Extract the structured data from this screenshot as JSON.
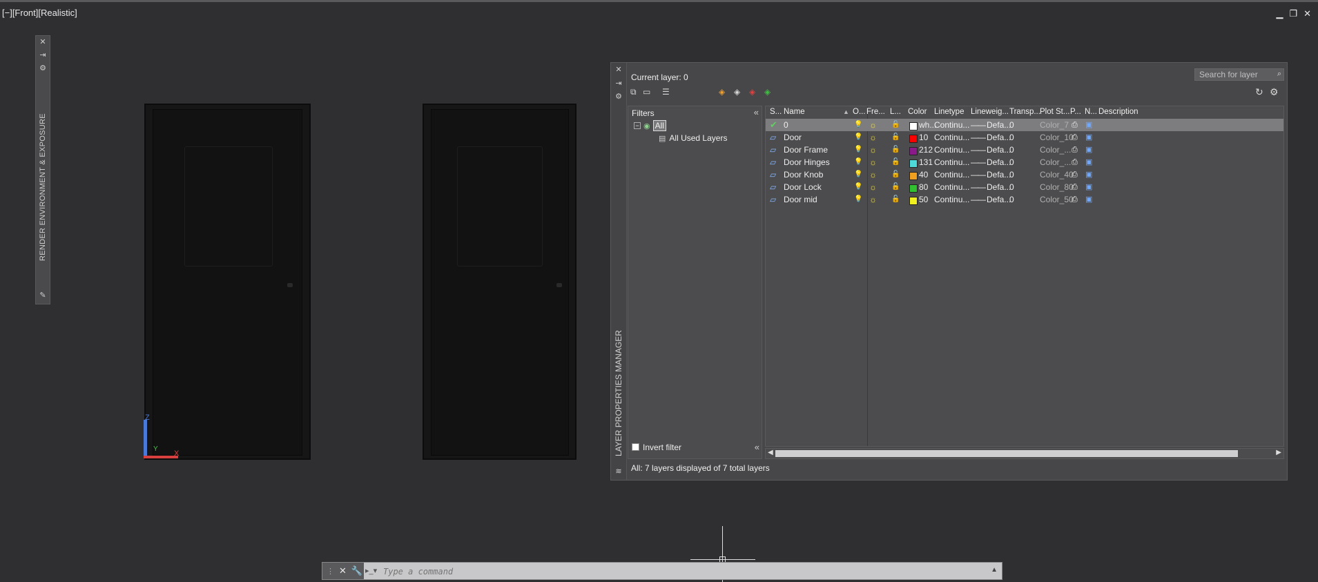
{
  "viewport": {
    "label": "[−][Front][Realistic]"
  },
  "window_controls": {
    "minimize": "▁",
    "restore": "❐",
    "close": "✕"
  },
  "render_palette": {
    "title": "RENDER ENVIRONMENT & EXPOSURE",
    "icons": [
      "close-icon",
      "pin-icon",
      "settings-icon",
      "properties-icon"
    ]
  },
  "layer_manager": {
    "title": "LAYER PROPERTIES MANAGER",
    "current_layer": "Current layer: 0",
    "search_placeholder": "Search for layer",
    "filters": {
      "header": "Filters",
      "tree_root": "All",
      "tree_child": "All Used Layers",
      "invert_filter": "Invert filter"
    },
    "columns": [
      "S...",
      "Name",
      "O...",
      "Fre...",
      "L...",
      "Color",
      "Linetype",
      "Lineweig...",
      "Transp...",
      "Plot St...",
      "P...",
      "N...",
      "Description"
    ],
    "layers": [
      {
        "status": "current",
        "name": "0",
        "color_hex": "#ffffff",
        "color_name": "wh...",
        "linetype": "Continu...",
        "lineweight": "Defa...",
        "transparency": "0",
        "plot_style": "Color_7"
      },
      {
        "status": "",
        "name": "Door",
        "color_hex": "#ff0000",
        "color_name": "10",
        "linetype": "Continu...",
        "lineweight": "Defa...",
        "transparency": "0",
        "plot_style": "Color_10"
      },
      {
        "status": "",
        "name": "Door Frame",
        "color_hex": "#8a1a8a",
        "color_name": "212",
        "linetype": "Continu...",
        "lineweight": "Defa...",
        "transparency": "0",
        "plot_style": "Color_..."
      },
      {
        "status": "",
        "name": "Door Hinges",
        "color_hex": "#4fd8d8",
        "color_name": "131",
        "linetype": "Continu...",
        "lineweight": "Defa...",
        "transparency": "0",
        "plot_style": "Color_..."
      },
      {
        "status": "",
        "name": "Door Knob",
        "color_hex": "#f0a020",
        "color_name": "40",
        "linetype": "Continu...",
        "lineweight": "Defa...",
        "transparency": "0",
        "plot_style": "Color_40"
      },
      {
        "status": "",
        "name": "Door Lock",
        "color_hex": "#30c030",
        "color_name": "80",
        "linetype": "Continu...",
        "lineweight": "Defa...",
        "transparency": "0",
        "plot_style": "Color_80"
      },
      {
        "status": "",
        "name": "Door mid",
        "color_hex": "#f0f020",
        "color_name": "50",
        "linetype": "Continu...",
        "lineweight": "Defa...",
        "transparency": "0",
        "plot_style": "Color_50"
      }
    ],
    "status_text": "All: 7 layers displayed of 7 total layers"
  },
  "ucs": {
    "z": "Z",
    "y": "Y",
    "x": "X"
  },
  "command_line": {
    "placeholder": "Type a command"
  }
}
